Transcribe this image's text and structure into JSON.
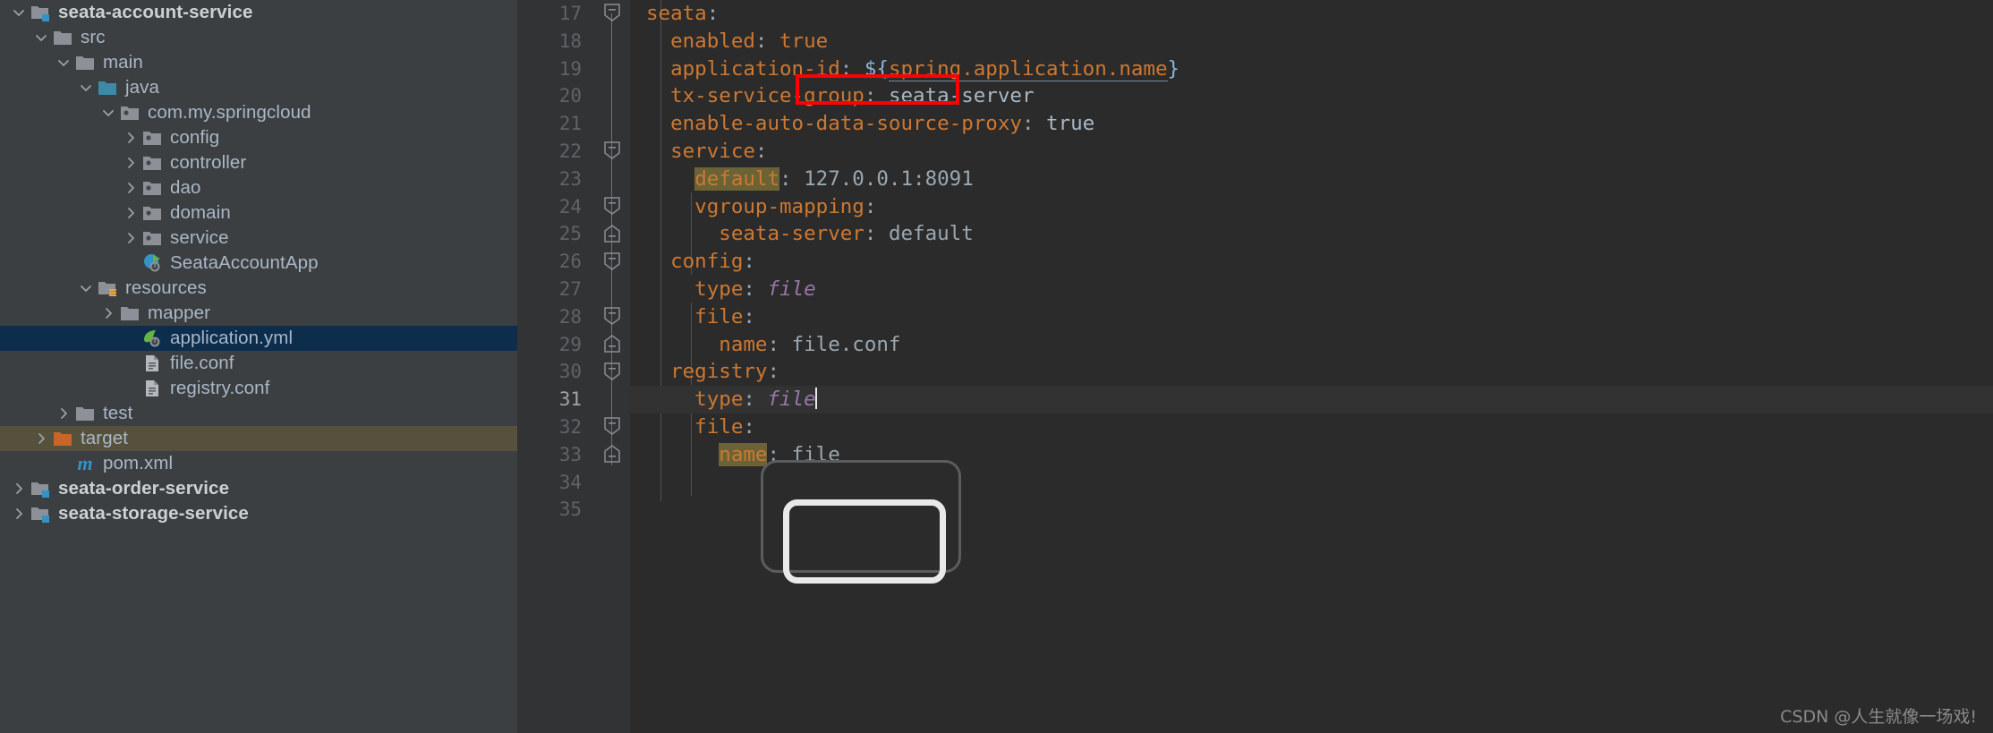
{
  "project_tree": {
    "items": [
      {
        "label": "seata-account-service",
        "indent": 0,
        "twisty": "down",
        "icon": "module-folder-icon",
        "bold": true,
        "state": "normal"
      },
      {
        "label": "src",
        "indent": 1,
        "twisty": "down",
        "icon": "folder-icon",
        "bold": false,
        "state": "normal"
      },
      {
        "label": "main",
        "indent": 2,
        "twisty": "down",
        "icon": "folder-icon",
        "bold": false,
        "state": "normal"
      },
      {
        "label": "java",
        "indent": 3,
        "twisty": "down",
        "icon": "source-folder-icon",
        "bold": false,
        "state": "normal"
      },
      {
        "label": "com.my.springcloud",
        "indent": 4,
        "twisty": "down",
        "icon": "package-icon",
        "bold": false,
        "state": "normal"
      },
      {
        "label": "config",
        "indent": 5,
        "twisty": "right",
        "icon": "package-icon",
        "bold": false,
        "state": "normal"
      },
      {
        "label": "controller",
        "indent": 5,
        "twisty": "right",
        "icon": "package-icon",
        "bold": false,
        "state": "normal"
      },
      {
        "label": "dao",
        "indent": 5,
        "twisty": "right",
        "icon": "package-icon",
        "bold": false,
        "state": "normal"
      },
      {
        "label": "domain",
        "indent": 5,
        "twisty": "right",
        "icon": "package-icon",
        "bold": false,
        "state": "normal"
      },
      {
        "label": "service",
        "indent": 5,
        "twisty": "right",
        "icon": "package-icon",
        "bold": false,
        "state": "normal"
      },
      {
        "label": "SeataAccountApp",
        "indent": 5,
        "twisty": "none",
        "icon": "spring-boot-class-icon",
        "bold": false,
        "state": "normal"
      },
      {
        "label": "resources",
        "indent": 3,
        "twisty": "down",
        "icon": "resources-folder-icon",
        "bold": false,
        "state": "normal"
      },
      {
        "label": "mapper",
        "indent": 4,
        "twisty": "right",
        "icon": "folder-icon",
        "bold": false,
        "state": "normal"
      },
      {
        "label": "application.yml",
        "indent": 5,
        "twisty": "none",
        "icon": "spring-yaml-icon",
        "bold": false,
        "state": "selected"
      },
      {
        "label": "file.conf",
        "indent": 5,
        "twisty": "none",
        "icon": "conf-file-icon",
        "bold": false,
        "state": "normal"
      },
      {
        "label": "registry.conf",
        "indent": 5,
        "twisty": "none",
        "icon": "conf-file-icon",
        "bold": false,
        "state": "normal"
      },
      {
        "label": "test",
        "indent": 2,
        "twisty": "right",
        "icon": "folder-icon",
        "bold": false,
        "state": "normal"
      },
      {
        "label": "target",
        "indent": 1,
        "twisty": "right",
        "icon": "excluded-folder-icon",
        "bold": false,
        "state": "target"
      },
      {
        "label": "pom.xml",
        "indent": 2,
        "twisty": "none",
        "icon": "maven-icon",
        "bold": false,
        "state": "normal"
      },
      {
        "label": "seata-order-service",
        "indent": 0,
        "twisty": "right",
        "icon": "module-folder-icon",
        "bold": true,
        "state": "normal"
      },
      {
        "label": "seata-storage-service",
        "indent": 0,
        "twisty": "right",
        "icon": "module-folder-icon",
        "bold": true,
        "state": "normal"
      }
    ]
  },
  "editor": {
    "file": "application.yml",
    "current_line": 31,
    "first_line_number": 17,
    "lines": [
      {
        "n": 17,
        "fold": "start",
        "tokens": [
          {
            "t": "seata",
            "c": "key"
          },
          {
            "t": ":",
            "c": "punct"
          }
        ]
      },
      {
        "n": 18,
        "fold": "none",
        "tokens": [
          {
            "t": "  enabled",
            "c": "key"
          },
          {
            "t": ":",
            "c": "punct"
          },
          {
            "t": " ",
            "c": "val"
          },
          {
            "t": "true",
            "c": "key"
          }
        ]
      },
      {
        "n": 19,
        "fold": "none",
        "tokens": [
          {
            "t": "  application-id",
            "c": "key"
          },
          {
            "t": ":",
            "c": "punct"
          },
          {
            "t": " ",
            "c": "val"
          },
          {
            "t": "${",
            "c": "brace"
          },
          {
            "t": "spring.application.name",
            "c": "link"
          },
          {
            "t": "}",
            "c": "brace"
          }
        ]
      },
      {
        "n": 20,
        "fold": "none",
        "tokens": [
          {
            "t": "  tx-service-group",
            "c": "key"
          },
          {
            "t": ":",
            "c": "punct"
          },
          {
            "t": " ",
            "c": "val"
          },
          {
            "t": "seata-server",
            "c": "val"
          }
        ]
      },
      {
        "n": 21,
        "fold": "none",
        "tokens": [
          {
            "t": "  enable-auto-data-source-proxy",
            "c": "key"
          },
          {
            "t": ":",
            "c": "punct"
          },
          {
            "t": " ",
            "c": "val"
          },
          {
            "t": "true",
            "c": "val"
          }
        ]
      },
      {
        "n": 22,
        "fold": "start",
        "tokens": [
          {
            "t": "  service",
            "c": "key"
          },
          {
            "t": ":",
            "c": "punct"
          }
        ]
      },
      {
        "n": 23,
        "fold": "none",
        "tokens": [
          {
            "t": "    ",
            "c": "val"
          },
          {
            "t": "default",
            "c": "key hl-ident"
          },
          {
            "t": ":",
            "c": "punct"
          },
          {
            "t": " ",
            "c": "val"
          },
          {
            "t": "127.0.0.1:8091",
            "c": "num"
          }
        ]
      },
      {
        "n": 24,
        "fold": "start",
        "tokens": [
          {
            "t": "    vgroup-mapping",
            "c": "key"
          },
          {
            "t": ":",
            "c": "punct"
          }
        ]
      },
      {
        "n": 25,
        "fold": "end",
        "tokens": [
          {
            "t": "      seata-server",
            "c": "key"
          },
          {
            "t": ":",
            "c": "punct"
          },
          {
            "t": " ",
            "c": "val"
          },
          {
            "t": "default",
            "c": "num"
          }
        ]
      },
      {
        "n": 26,
        "fold": "start",
        "tokens": [
          {
            "t": "  config",
            "c": "key"
          },
          {
            "t": ":",
            "c": "punct"
          }
        ]
      },
      {
        "n": 27,
        "fold": "none",
        "tokens": [
          {
            "t": "    type",
            "c": "key"
          },
          {
            "t": ":",
            "c": "punct"
          },
          {
            "t": " ",
            "c": "val"
          },
          {
            "t": "file",
            "c": "kw-italic"
          }
        ]
      },
      {
        "n": 28,
        "fold": "start",
        "tokens": [
          {
            "t": "    file",
            "c": "key"
          },
          {
            "t": ":",
            "c": "punct"
          }
        ]
      },
      {
        "n": 29,
        "fold": "end",
        "tokens": [
          {
            "t": "      name",
            "c": "key"
          },
          {
            "t": ":",
            "c": "punct"
          },
          {
            "t": " ",
            "c": "val"
          },
          {
            "t": "file.conf",
            "c": "num"
          }
        ]
      },
      {
        "n": 30,
        "fold": "start",
        "tokens": [
          {
            "t": "  registry",
            "c": "key"
          },
          {
            "t": ":",
            "c": "punct"
          }
        ]
      },
      {
        "n": 31,
        "fold": "none",
        "tokens": [
          {
            "t": "    type",
            "c": "key"
          },
          {
            "t": ":",
            "c": "punct"
          },
          {
            "t": " ",
            "c": "val"
          },
          {
            "t": "file",
            "c": "kw-italic"
          },
          {
            "t": "|",
            "c": "caret"
          }
        ]
      },
      {
        "n": 32,
        "fold": "start",
        "tokens": [
          {
            "t": "    file",
            "c": "key"
          },
          {
            "t": ":",
            "c": "punct"
          }
        ]
      },
      {
        "n": 33,
        "fold": "end",
        "tokens": [
          {
            "t": "      ",
            "c": "val"
          },
          {
            "t": "name",
            "c": "key hl-ident"
          },
          {
            "t": ":",
            "c": "punct"
          },
          {
            "t": " ",
            "c": "val"
          },
          {
            "t": "file",
            "c": "num"
          }
        ]
      },
      {
        "n": 34,
        "fold": "none",
        "tokens": []
      },
      {
        "n": 35,
        "fold": "none",
        "tokens": []
      }
    ],
    "annotation": {
      "type": "red-rectangle",
      "color": "#ff0000",
      "around_text": "seata-server",
      "on_line": 20
    }
  },
  "watermark": {
    "text": "CSDN @人生就像一场戏!"
  },
  "colors": {
    "tree_background": "#3c3f41",
    "editor_background": "#2b2b2b",
    "gutter_background": "#313335",
    "selection": "#0d2d4d",
    "target_row": "#55513d",
    "key_color": "#cc7832",
    "value_color": "#a9b7c6",
    "italic_value_color": "#9876aa",
    "annotation_red": "#ff0000",
    "identifier_highlight": "#6b6335"
  }
}
